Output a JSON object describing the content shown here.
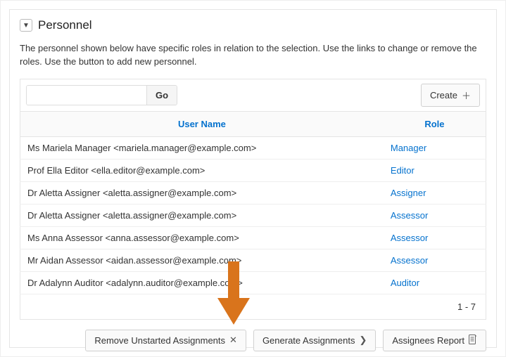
{
  "panel": {
    "title": "Personnel",
    "description": "The personnel shown below have specific roles in relation to the selection. Use the links to change or remove the roles. Use the button to add new personnel."
  },
  "toolbar": {
    "go_label": "Go",
    "create_label": "Create"
  },
  "table": {
    "columns": {
      "user": "User Name",
      "role": "Role"
    },
    "rows": [
      {
        "user": "Ms Mariela Manager <mariela.manager@example.com>",
        "role": "Manager"
      },
      {
        "user": "Prof Ella Editor <ella.editor@example.com>",
        "role": "Editor"
      },
      {
        "user": "Dr Aletta Assigner <aletta.assigner@example.com>",
        "role": "Assigner"
      },
      {
        "user": "Dr Aletta Assigner <aletta.assigner@example.com>",
        "role": "Assessor"
      },
      {
        "user": "Ms Anna Assessor <anna.assessor@example.com>",
        "role": "Assessor"
      },
      {
        "user": "Mr Aidan Assessor <aidan.assessor@example.com>",
        "role": "Assessor"
      },
      {
        "user": "Dr Adalynn Auditor <adalynn.auditor@example.com>",
        "role": "Auditor"
      }
    ],
    "pagination": "1 - 7"
  },
  "actions": {
    "remove": "Remove Unstarted Assignments",
    "generate": "Generate Assignments",
    "report": "Assignees Report"
  }
}
